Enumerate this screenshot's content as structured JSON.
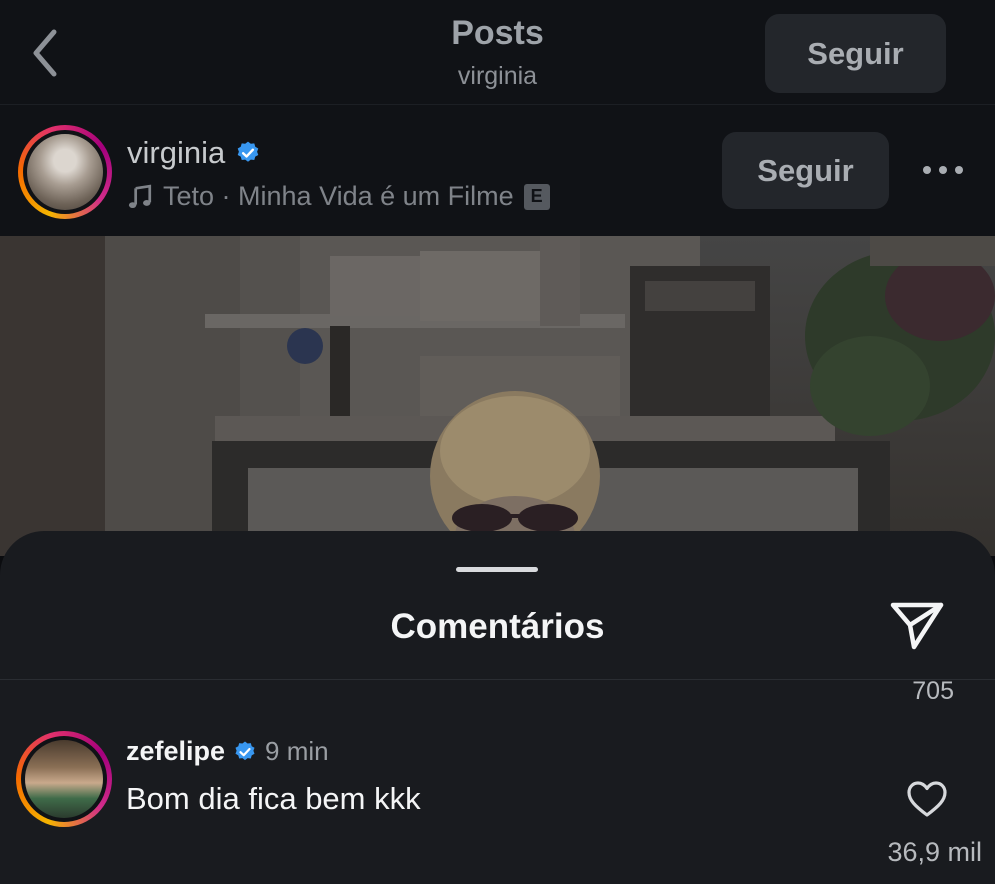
{
  "header": {
    "title": "Posts",
    "subtitle": "virginia",
    "follow_label": "Seguir"
  },
  "post": {
    "author": "virginia",
    "verified": true,
    "music": "Teto · Minha Vida é um Filme",
    "explicit_badge": "E",
    "follow_label": "Seguir",
    "more_icon": "more-horizontal-icon"
  },
  "comments_sheet": {
    "title": "Comentários",
    "share_count": "705",
    "comments": [
      {
        "user": "zefelipe",
        "verified": true,
        "time": "9 min",
        "text": "Bom dia fica bem kkk",
        "likes": "36,9 mil"
      }
    ]
  },
  "colors": {
    "background": "#0b0c0f",
    "bar": "#101216",
    "sheet": "#191b1f",
    "button": "#23262b",
    "verified_blue": "#3897f0"
  }
}
